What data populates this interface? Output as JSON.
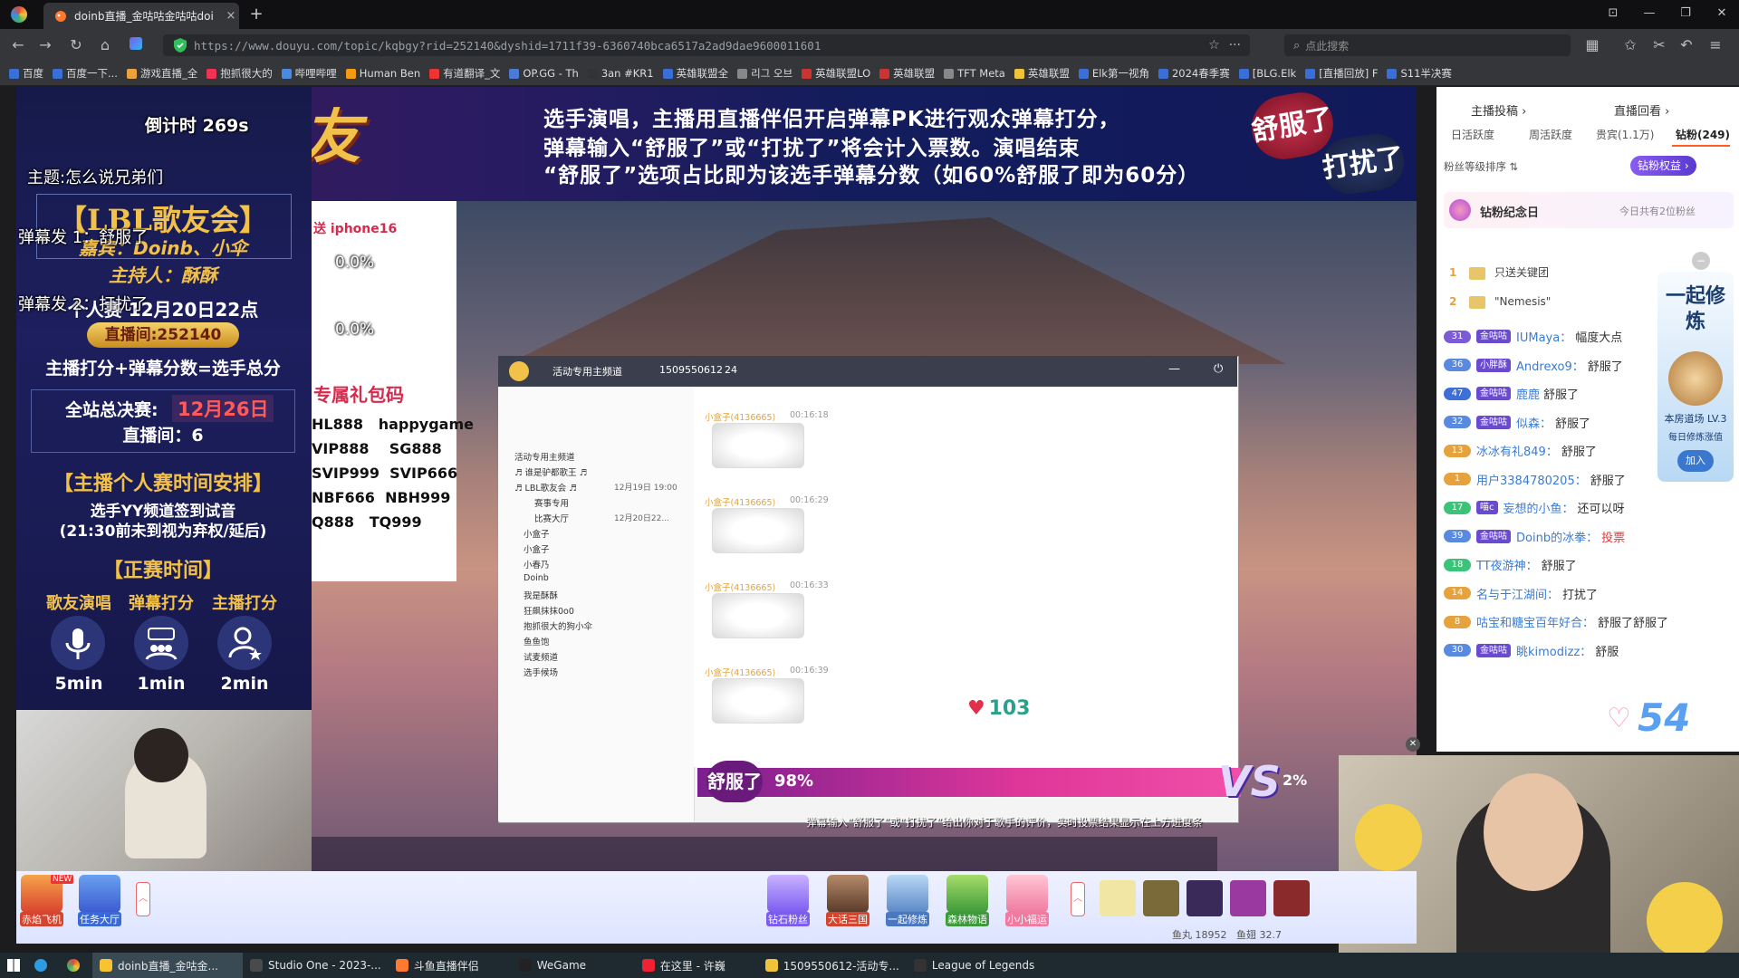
{
  "browser": {
    "tab_title": "doinb直播_金咕咕金咕咕doi",
    "close_glyph": "×",
    "new_tab_glyph": "+",
    "url": "https://www.douyu.com/topic/kqbgy?rid=252140&dyshid=1711f39-6360740bca6517a2ad9dae9600011601",
    "search_placeholder": "点此搜索",
    "bookmarks": [
      "百度",
      "百度一下...",
      "游戏直播_全",
      "抱抓很大的",
      "哔哩哔哩",
      "Human Ben",
      "有道翻译_文",
      "OP.GG - Th",
      "3an #KR1",
      "英雄联盟全",
      "리그 오브",
      "英雄联盟LO",
      "英雄联盟",
      "TFT Meta",
      "英雄联盟",
      "Elk第一视角",
      "2024春季赛",
      "[BLG.Elk",
      "[直播回放] F",
      "S11半决赛"
    ]
  },
  "banner": {
    "big_title": "开腔吧!歌友",
    "line1": "选手演唱，主播用直播伴侣开启弹幕PK进行观众弹幕打分，",
    "line2": "弹幕输入“舒服了”或“打扰了”将会计入票数。演唱结束",
    "line3": "“舒服了”选项占比即为该选手弹幕分数（如60%舒服了即为60分）",
    "badge_comfy": "舒服了",
    "badge_disturb": "打扰了"
  },
  "overlay": {
    "countdown": "倒计时 269s",
    "topic": "主题:怎么说兄弟们",
    "danmu1": "弹幕发 1：舒服了",
    "danmu2": "弹幕发 2：打扰了",
    "pct1": "0.0%",
    "pct2": "0.0%"
  },
  "left_panel": {
    "event_title": "【LBL歌友会】",
    "guests": "嘉宾：Doinb、小伞",
    "host": "主持人：酥酥",
    "time": "个人赛 12月20日22点",
    "room_pill": "直播间:252140",
    "scoring": "主播打分+弹幕分数=选手总分",
    "final_label": "全站总决赛:",
    "final_date": "12月26日",
    "final_room": "直播间：6",
    "schedule_title": "【主播个人赛时间安排】",
    "schedule_l1": "选手YY频道签到试音",
    "schedule_l2": "(21:30前未到视为弃权/延后)",
    "main_title": "【正赛时间】",
    "seg_sing": "歌友演唱",
    "seg_danmu": "弹幕打分",
    "seg_host": "主播打分",
    "dur_sing": "5min",
    "dur_danmu": "1min",
    "dur_host": "2min"
  },
  "promo": {
    "iphone": "送 iphone16",
    "gift_title": "专属礼包码",
    "codes": [
      "HL888",
      "happygame",
      "VIP888",
      "SG888",
      "SVIP999",
      "SVIP666",
      "NBF666",
      "NBH999",
      "Q888",
      "TQ999"
    ]
  },
  "inner_window": {
    "title": "活动专用主频道",
    "room_id": "1509550612",
    "count": "24",
    "list_items": [
      "活动专用主频道",
      "♬ 谁是驴都歌王 ♬",
      "♬ LBL歌友会 ♬",
      "赛事专用",
      "比赛大厅",
      "小盒子",
      "小盒子",
      "小春乃",
      "Doinb",
      "我是酥酥",
      "狂飙抹抹0o0",
      "抱抓很大的狗小伞",
      "鱼鱼饱",
      "试麦频道",
      "选手候场"
    ],
    "list_dates": [
      "12月19日 19:00",
      "12月20日22..."
    ],
    "chat_user": "小盒子(4136665)",
    "chat_times": [
      "00:16:18",
      "00:16:29",
      "00:16:33",
      "00:16:39"
    ],
    "hearts": "103",
    "vote_pct": "98%",
    "vote_other_pct": "2%",
    "vote_label": "舒服了",
    "footer_hint": "弹幕输入“舒服了”或“打扰了”给出你对于歌手的评价，实时投票结果显示在上方进度条"
  },
  "gift_bar": {
    "left_items": [
      "赤焰飞机",
      "任务大厅"
    ],
    "items": [
      "钻石粉丝",
      "大话三国",
      "一起修炼",
      "森林物语",
      "小小福运"
    ],
    "new_tag": "NEW"
  },
  "sidebar": {
    "host_invest": "主播投稿 ›",
    "replay": "直播回看 ›",
    "tabs": [
      "日活跃度",
      "周活跃度",
      "贵宾(1.1万)",
      "钻粉(249)"
    ],
    "sort_label": "粉丝等级排序 ⇅",
    "diamond_rights": "钻粉权益 ›",
    "anniversary": "钻粉纪念日",
    "anniv_count": "今日共有2位粉丝",
    "rank": [
      {
        "n": "1",
        "name": "只送关键团"
      },
      {
        "n": "2",
        "name": "\"Nemesis\""
      }
    ],
    "chats": [
      {
        "lv": "31",
        "medal": "金咕咕",
        "nick": "IUMaya：",
        "msg": "幅度大点",
        "color": "#7c5cd6"
      },
      {
        "lv": "36",
        "medal": "小胖酥",
        "nick": "Andrexo9：",
        "msg": "舒服了",
        "color": "#5a8ae0"
      },
      {
        "lv": "47",
        "medal": "金咕咕",
        "nick": "鹿鹿",
        "msg": "舒服了",
        "color": "#3e6fd8"
      },
      {
        "lv": "32",
        "medal": "金咕咕",
        "nick": "似森：",
        "msg": "舒服了",
        "color": "#5a8ae0"
      },
      {
        "lv": "13",
        "medal": "",
        "nick": "冰冰有礼849：",
        "msg": "舒服了",
        "color": "#e6a23c"
      },
      {
        "lv": "1",
        "medal": "",
        "nick": "用户3384780205：",
        "msg": "舒服了",
        "color": "#e6a23c"
      },
      {
        "lv": "17",
        "medal": "喵c",
        "nick": "妄想的小鱼：",
        "msg": "还可以呀",
        "color": "#3cc37a"
      },
      {
        "lv": "39",
        "medal": "金咕咕",
        "nick": "Doinb的冰拳：",
        "msg": "投票",
        "color": "#5a8ae0"
      },
      {
        "lv": "18",
        "medal": "",
        "nick": "TT夜游神：",
        "msg": "舒服了",
        "color": "#3cc37a"
      },
      {
        "lv": "14",
        "medal": "",
        "nick": "名与于江湖间：",
        "msg": "打扰了",
        "color": "#e6a23c"
      },
      {
        "lv": "8",
        "medal": "",
        "nick": "咕宝和糖宝百年好合：",
        "msg": "舒服了舒服了",
        "color": "#e6a23c"
      },
      {
        "lv": "30",
        "medal": "金咕咕",
        "nick": "眺kimodizz：",
        "msg": "舒服",
        "color": "#5a8ae0"
      }
    ],
    "like_count": "54",
    "cultivate_title": "一起修炼",
    "cultivate_sub": "本房道场 LV.3",
    "cultivate_sub2": "每日修炼涨值",
    "cultivate_join": "加入",
    "stats_fishball": "鱼丸 18952",
    "stats_fishwing": "鱼翅 32.7"
  },
  "taskbar": {
    "items": [
      "doinb直播_金咕金...",
      "Studio One - 2023-...",
      "斗鱼直播伴侣",
      "WeGame",
      "在这里 - 许巍",
      "1509550612-活动专...",
      "League of Legends"
    ]
  },
  "colors": {
    "accent_gold": "#f2c14a",
    "accent_red": "#d42c4e",
    "vote_pink": "#e0369a",
    "douyu_orange": "#ff5d23"
  }
}
